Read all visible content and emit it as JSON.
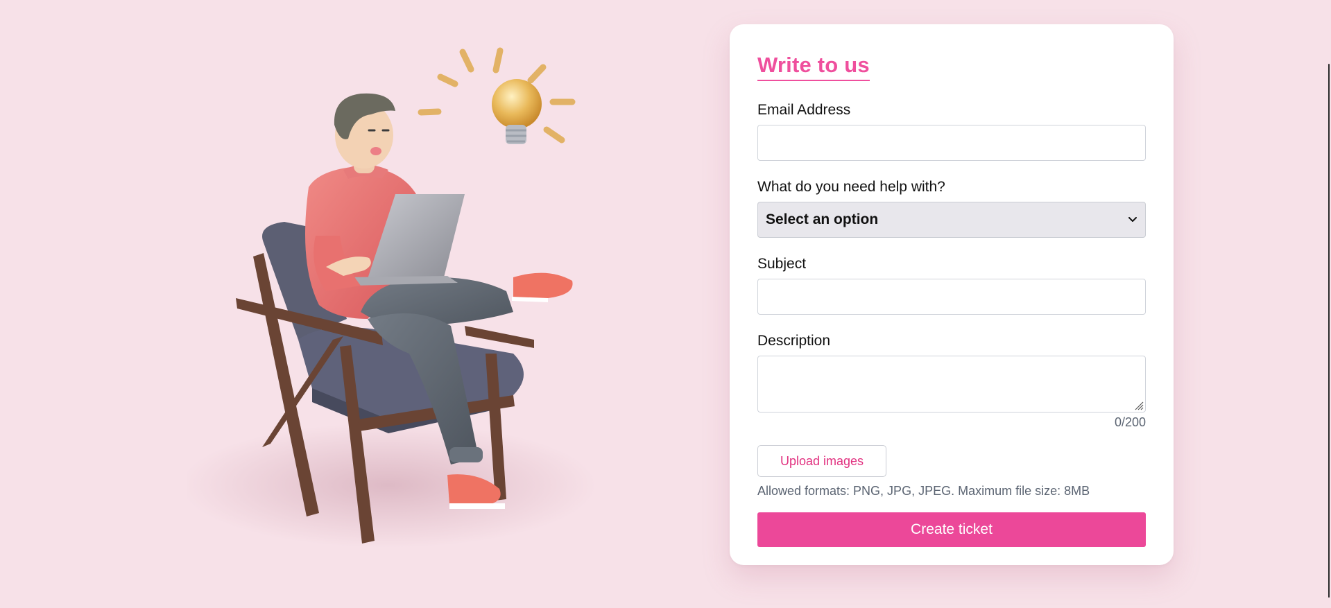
{
  "form": {
    "title": "Write to us",
    "email": {
      "label": "Email Address",
      "value": "",
      "placeholder": ""
    },
    "help": {
      "label": "What do you need help with?",
      "selected": "Select an option"
    },
    "subject": {
      "label": "Subject",
      "value": "",
      "placeholder": ""
    },
    "description": {
      "label": "Description",
      "value": "",
      "counter": "0/200"
    },
    "upload_label": "Upload images",
    "hint": "Allowed formats: PNG, JPG, JPEG. Maximum file size: 8MB",
    "submit_label": "Create ticket"
  },
  "icons": {
    "select_chevron": "chevron-down-icon",
    "resize_handle": "resize-handle-icon"
  },
  "colors": {
    "page_background": "#f7e1e8",
    "accent": "#ec4899",
    "title": "#ef4f9d",
    "upload_text": "#e1307f",
    "select_background": "#e8e7ec"
  }
}
